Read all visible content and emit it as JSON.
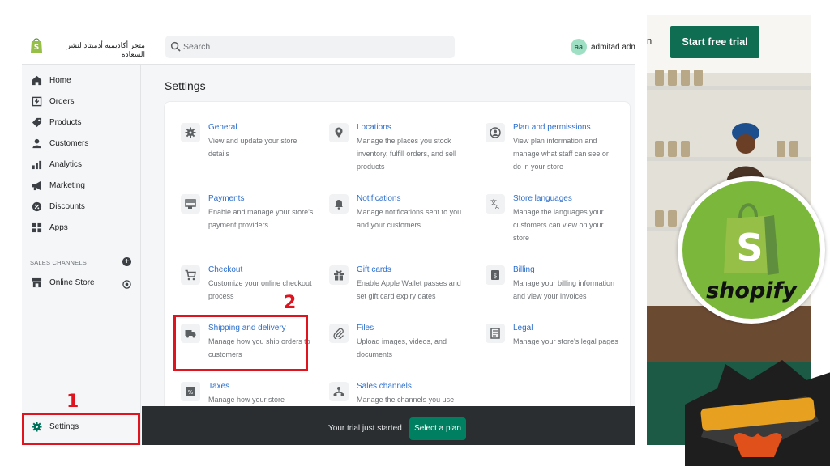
{
  "admin": {
    "store_name": "متجر أكاديمية أدميتاد لنشر السعادة",
    "search_placeholder": "Search",
    "avatar_initials": "aa",
    "user_name": "admitad adm",
    "page_title": "Settings"
  },
  "sidebar": {
    "items": [
      {
        "label": "Home",
        "icon": "home-icon"
      },
      {
        "label": "Orders",
        "icon": "orders-icon"
      },
      {
        "label": "Products",
        "icon": "tag-icon"
      },
      {
        "label": "Customers",
        "icon": "person-icon"
      },
      {
        "label": "Analytics",
        "icon": "bar-chart-icon"
      },
      {
        "label": "Marketing",
        "icon": "megaphone-icon"
      },
      {
        "label": "Discounts",
        "icon": "discount-icon"
      },
      {
        "label": "Apps",
        "icon": "apps-icon"
      }
    ],
    "sales_channels_label": "SALES CHANNELS",
    "online_store_label": "Online Store",
    "settings_label": "Settings"
  },
  "settings": [
    {
      "title": "General",
      "desc": "View and update your store details",
      "icon": "gear-icon"
    },
    {
      "title": "Locations",
      "desc": "Manage the places you stock inventory, fulfill orders, and sell products",
      "icon": "location-pin-icon"
    },
    {
      "title": "Plan and permissions",
      "desc": "View plan information and manage what staff can see or do in your store",
      "icon": "profile-icon"
    },
    {
      "title": "Payments",
      "desc": "Enable and manage your store's payment providers",
      "icon": "payments-icon"
    },
    {
      "title": "Notifications",
      "desc": "Manage notifications sent to you and your customers",
      "icon": "bell-icon"
    },
    {
      "title": "Store languages",
      "desc": "Manage the languages your customers can view on your store",
      "icon": "translate-icon"
    },
    {
      "title": "Checkout",
      "desc": "Customize your online checkout process",
      "icon": "cart-icon"
    },
    {
      "title": "Gift cards",
      "desc": "Enable Apple Wallet passes and set gift card expiry dates",
      "icon": "gift-icon"
    },
    {
      "title": "Billing",
      "desc": "Manage your billing information and view your invoices",
      "icon": "dollar-icon"
    },
    {
      "title": "Shipping and delivery",
      "desc": "Manage how you ship orders to customers",
      "icon": "truck-icon"
    },
    {
      "title": "Files",
      "desc": "Upload images, videos, and documents",
      "icon": "paperclip-icon"
    },
    {
      "title": "Legal",
      "desc": "Manage your store's legal pages",
      "icon": "legal-icon"
    },
    {
      "title": "Taxes",
      "desc": "Manage how your store",
      "icon": "taxes-icon"
    },
    {
      "title": "Sales channels",
      "desc": "Manage the channels you use to",
      "icon": "channels-icon"
    }
  ],
  "trial": {
    "text": "Your trial just started",
    "button": "Select a plan"
  },
  "annotations": {
    "step1": "1",
    "step2": "2"
  },
  "promo": {
    "button": "Start free trial",
    "partial_text": "n",
    "badge_word": "shopify"
  },
  "colors": {
    "accent_green": "#008060",
    "link_blue": "#2c6ecb",
    "highlight_red": "#e0141e",
    "shopify_green": "#7ab73a"
  }
}
